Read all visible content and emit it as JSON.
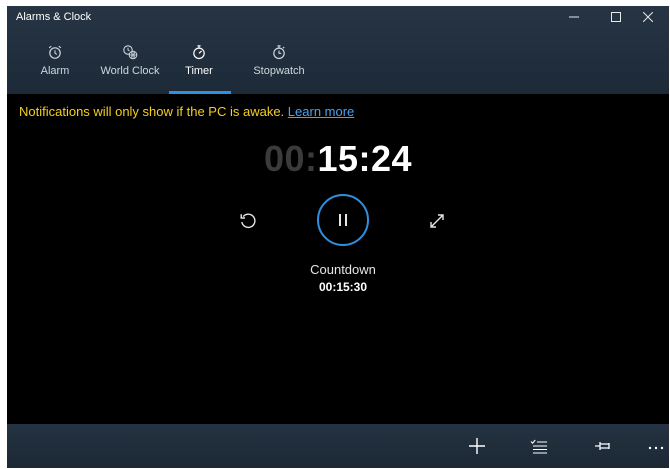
{
  "window": {
    "title": "Alarms & Clock"
  },
  "tabs": [
    {
      "label": "Alarm",
      "icon": "alarm-icon"
    },
    {
      "label": "World Clock",
      "icon": "world-clock-icon"
    },
    {
      "label": "Timer",
      "icon": "timer-icon",
      "selected": true
    },
    {
      "label": "Stopwatch",
      "icon": "stopwatch-icon"
    }
  ],
  "notice": {
    "text": "Notifications will only show if the PC is awake.",
    "link": "Learn more"
  },
  "timer": {
    "hours": "00:",
    "rest": "15:24",
    "label": "Countdown",
    "duration": "00:15:30"
  },
  "colors": {
    "accent": "#2f8fe0",
    "notice": "#f4cf1e",
    "link": "#4aa3f2",
    "chrome": "#263444"
  },
  "toolbar": {
    "icons": [
      "add-icon",
      "select-icon",
      "pin-icon",
      "more-icon"
    ]
  }
}
